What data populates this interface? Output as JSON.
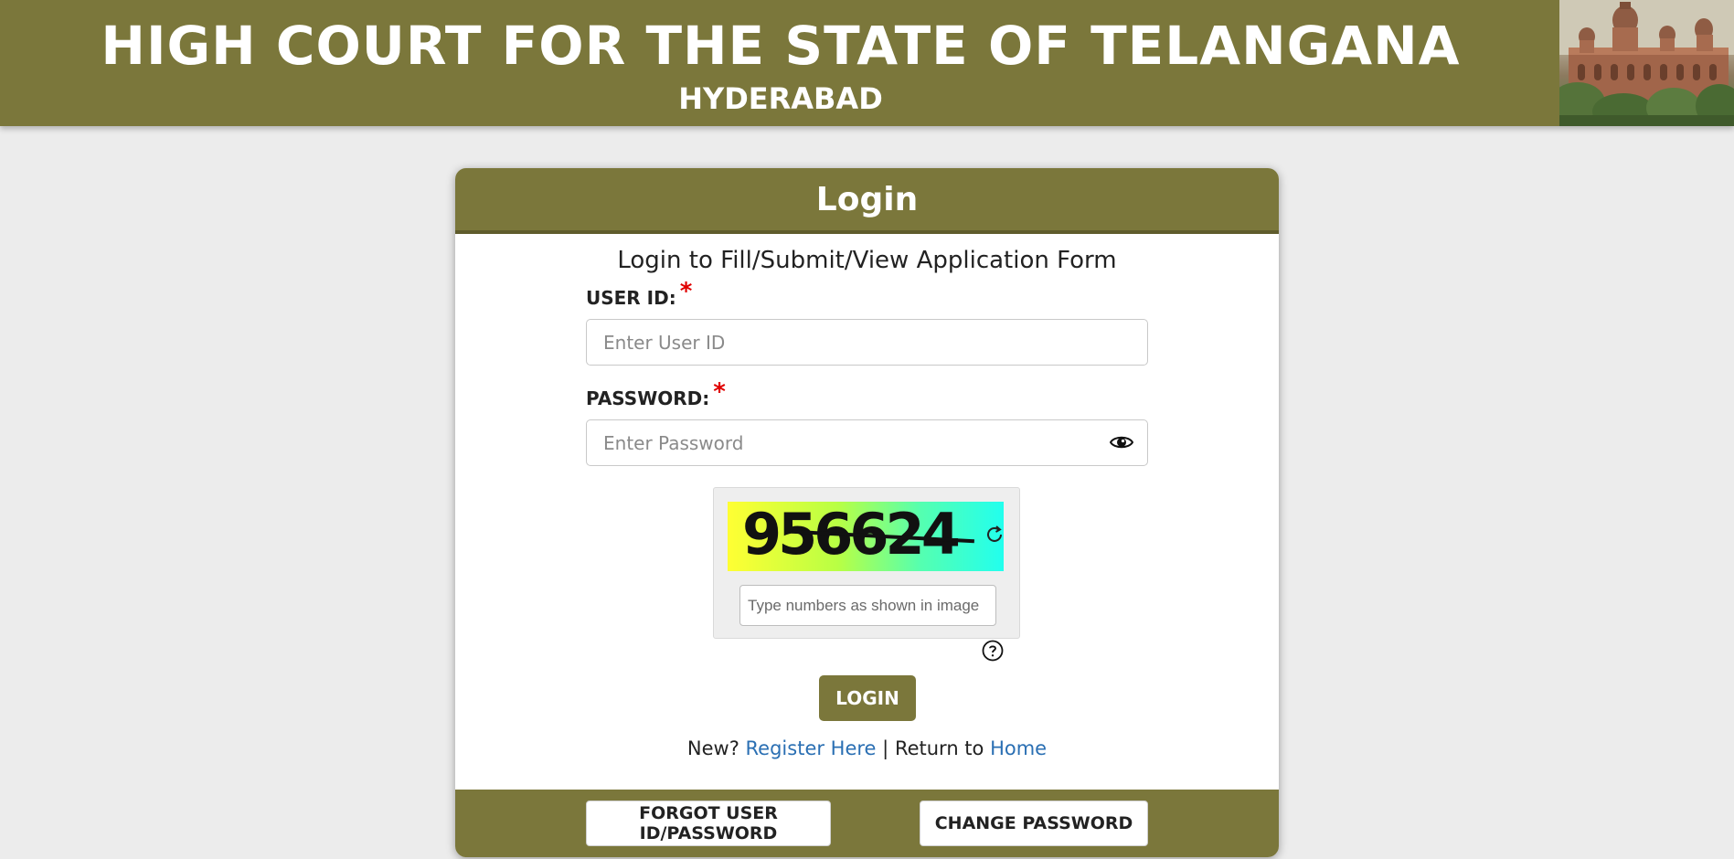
{
  "banner": {
    "title": "HIGH COURT FOR THE STATE OF TELANGANA",
    "subtitle": "HYDERABAD"
  },
  "card": {
    "header": "Login",
    "subtitle": "Login to Fill/Submit/View Application Form"
  },
  "form": {
    "user_id_label": "USER ID:",
    "user_id_placeholder": "Enter User ID",
    "user_id_value": "",
    "password_label": "PASSWORD:",
    "password_placeholder": "Enter Password",
    "password_value": "",
    "required_marker": "*"
  },
  "captcha": {
    "code": "956624",
    "input_placeholder": "Type numbers as shown in image",
    "input_value": ""
  },
  "actions": {
    "login_label": "LOGIN"
  },
  "links": {
    "new_text": "New?",
    "register_label": "Register Here",
    "separator": "|",
    "return_text": "Return to",
    "home_label": "Home"
  },
  "footer": {
    "forgot_label": "FORGOT USER ID/PASSWORD",
    "change_password_label": "CHANGE PASSWORD"
  },
  "icons": {
    "password_toggle": "eye-icon",
    "captcha_refresh": "refresh-icon",
    "captcha_help": "question-circle-icon"
  },
  "colors": {
    "brand_olive": "#7b773b",
    "link_blue": "#2a6fb3",
    "required_red": "#e00000",
    "page_bg": "#ececec"
  }
}
